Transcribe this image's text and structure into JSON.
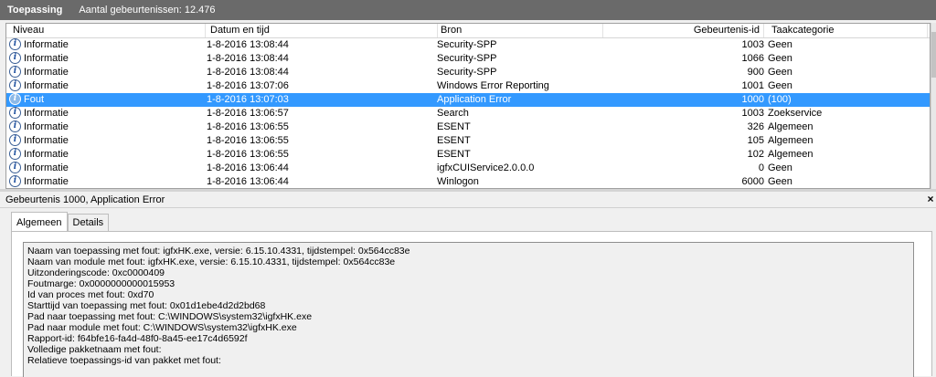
{
  "titlebar": {
    "title": "Toepassing",
    "count": "Aantal gebeurtenissen: 12.476"
  },
  "columns": {
    "level": "Niveau",
    "date": "Datum en tijd",
    "source": "Bron",
    "event_id": "Gebeurtenis-id",
    "category": "Taakcategorie"
  },
  "rows": [
    {
      "level": "Informatie",
      "date": "1-8-2016 13:08:44",
      "source": "Security-SPP",
      "event_id": "1003",
      "category": "Geen"
    },
    {
      "level": "Informatie",
      "date": "1-8-2016 13:08:44",
      "source": "Security-SPP",
      "event_id": "1066",
      "category": "Geen"
    },
    {
      "level": "Informatie",
      "date": "1-8-2016 13:08:44",
      "source": "Security-SPP",
      "event_id": "900",
      "category": "Geen"
    },
    {
      "level": "Informatie",
      "date": "1-8-2016 13:07:06",
      "source": "Windows Error Reporting",
      "event_id": "1001",
      "category": "Geen"
    },
    {
      "level": "Fout",
      "date": "1-8-2016 13:07:03",
      "source": "Application Error",
      "event_id": "1000",
      "category": "(100)"
    },
    {
      "level": "Informatie",
      "date": "1-8-2016 13:06:57",
      "source": "Search",
      "event_id": "1003",
      "category": "Zoekservice"
    },
    {
      "level": "Informatie",
      "date": "1-8-2016 13:06:55",
      "source": "ESENT",
      "event_id": "326",
      "category": "Algemeen"
    },
    {
      "level": "Informatie",
      "date": "1-8-2016 13:06:55",
      "source": "ESENT",
      "event_id": "105",
      "category": "Algemeen"
    },
    {
      "level": "Informatie",
      "date": "1-8-2016 13:06:55",
      "source": "ESENT",
      "event_id": "102",
      "category": "Algemeen"
    },
    {
      "level": "Informatie",
      "date": "1-8-2016 13:06:44",
      "source": "igfxCUIService2.0.0.0",
      "event_id": "0",
      "category": "Geen"
    },
    {
      "level": "Informatie",
      "date": "1-8-2016 13:06:44",
      "source": "Winlogon",
      "event_id": "6000",
      "category": "Geen"
    }
  ],
  "selected_row_index": 4,
  "detail": {
    "title": "Gebeurtenis 1000, Application Error",
    "close_glyph": "×",
    "tabs": [
      "Algemeen",
      "Details"
    ],
    "active_tab": 0,
    "message_lines": [
      "Naam van toepassing met fout: igfxHK.exe, versie: 6.15.10.4331, tijdstempel: 0x564cc83e",
      "Naam van module met fout: igfxHK.exe, versie: 6.15.10.4331, tijdstempel: 0x564cc83e",
      "Uitzonderingscode: 0xc0000409",
      "Foutmarge: 0x0000000000015953",
      "Id van proces met fout: 0xd70",
      "Starttijd van toepassing met fout: 0x01d1ebe4d2d2bd68",
      "Pad naar toepassing met fout: C:\\WINDOWS\\system32\\igfxHK.exe",
      "Pad naar module met fout: C:\\WINDOWS\\system32\\igfxHK.exe",
      "Rapport-id: f64bfe16-fa4d-48f0-8a45-ee17c4d6592f",
      "Volledige pakketnaam met fout:",
      "Relatieve toepassings-id van pakket met fout:"
    ]
  },
  "icons": {
    "info": "info-circle-icon",
    "error": "error-info-icon"
  },
  "colors": {
    "selection": "#3399ff",
    "titlebar": "#6a6a6a"
  }
}
